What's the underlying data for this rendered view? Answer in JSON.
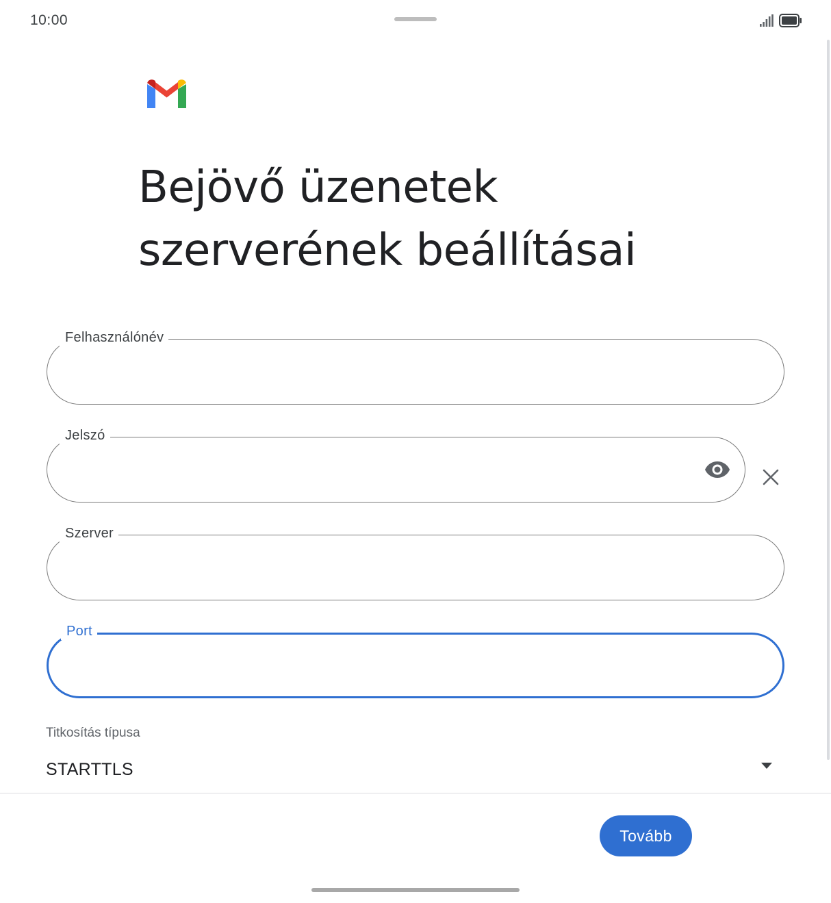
{
  "status_bar": {
    "time": "10:00",
    "icons": [
      "signal-icon",
      "battery-icon"
    ]
  },
  "app": {
    "logo": "gmail-logo"
  },
  "page": {
    "title_line1": "Bejövő üzenetek",
    "title_line2": "szerverének beállításai"
  },
  "form": {
    "username": {
      "label": "Felhasználónév",
      "value": ""
    },
    "password": {
      "label": "Jelszó",
      "value": ""
    },
    "server": {
      "label": "Szerver",
      "value": ""
    },
    "port": {
      "label": "Port",
      "value": ""
    },
    "encryption": {
      "label": "Titkosítás típusa",
      "selected": "STARTTLS"
    }
  },
  "footer": {
    "next_label": "Tovább"
  },
  "colors": {
    "accent": "#2f6fd1",
    "outline": "#7a7a7a",
    "text": "#202124",
    "gmail_red": "#ea4335",
    "gmail_blue": "#4285f4",
    "gmail_green": "#34a853",
    "gmail_yellow": "#fbbc04"
  }
}
